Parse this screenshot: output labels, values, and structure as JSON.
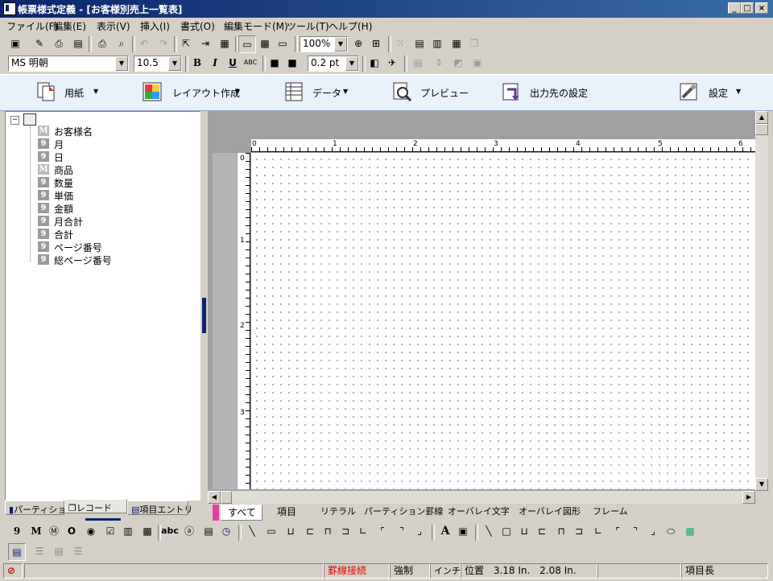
{
  "window": {
    "title": "帳票様式定義 - [お客様別売上一覧表]"
  },
  "menu": [
    "ファイル(F)",
    "編集(E)",
    "表示(V)",
    "挿入(I)",
    "書式(O)",
    "編集モード(M)",
    "ツール(T)",
    "ヘルプ(H)"
  ],
  "toolbar": {
    "zoom": "100%",
    "font_name": "MS 明朝",
    "font_size": "10.5",
    "line_width": "0.2 pt",
    "bold": "B",
    "italic": "I",
    "underline": "U",
    "strike": "ABC"
  },
  "ribbon": [
    "用紙",
    "レイアウト作成",
    "データ",
    "プレビュー",
    "出力先の設定",
    "設定"
  ],
  "tree": {
    "items": [
      {
        "type": "M",
        "label": "お客様名"
      },
      {
        "type": "9",
        "label": "月"
      },
      {
        "type": "9",
        "label": "日"
      },
      {
        "type": "M",
        "label": "商品"
      },
      {
        "type": "9",
        "label": "数量"
      },
      {
        "type": "9",
        "label": "単価"
      },
      {
        "type": "9",
        "label": "金額"
      },
      {
        "type": "9",
        "label": "月合計"
      },
      {
        "type": "9",
        "label": "合計"
      },
      {
        "type": "9",
        "label": "ページ番号"
      },
      {
        "type": "9",
        "label": "総ページ番号"
      }
    ]
  },
  "left_tabs": [
    "パーティション",
    "レコード",
    "項目エントリ"
  ],
  "rulers": {
    "h": [
      "0",
      "1",
      "2",
      "3",
      "4",
      "5",
      "6"
    ],
    "v": [
      "0",
      "1",
      "2",
      "3"
    ]
  },
  "bottom_tabs": [
    "すべて",
    "項目",
    "リテラル",
    "パーティション罫線",
    "オーバレイ文字",
    "オーバレイ図形",
    "フレーム"
  ],
  "palette": {
    "nine": "9",
    "m": "M",
    "o": "O",
    "abc": "abc",
    "a": "A"
  },
  "status": {
    "mode": "罫線接続",
    "force": "強制",
    "unit": "インチ",
    "pos_label": "位置",
    "pos_x": "3.18 In.",
    "pos_y": "2.08 In.",
    "item_len": "項目長"
  }
}
